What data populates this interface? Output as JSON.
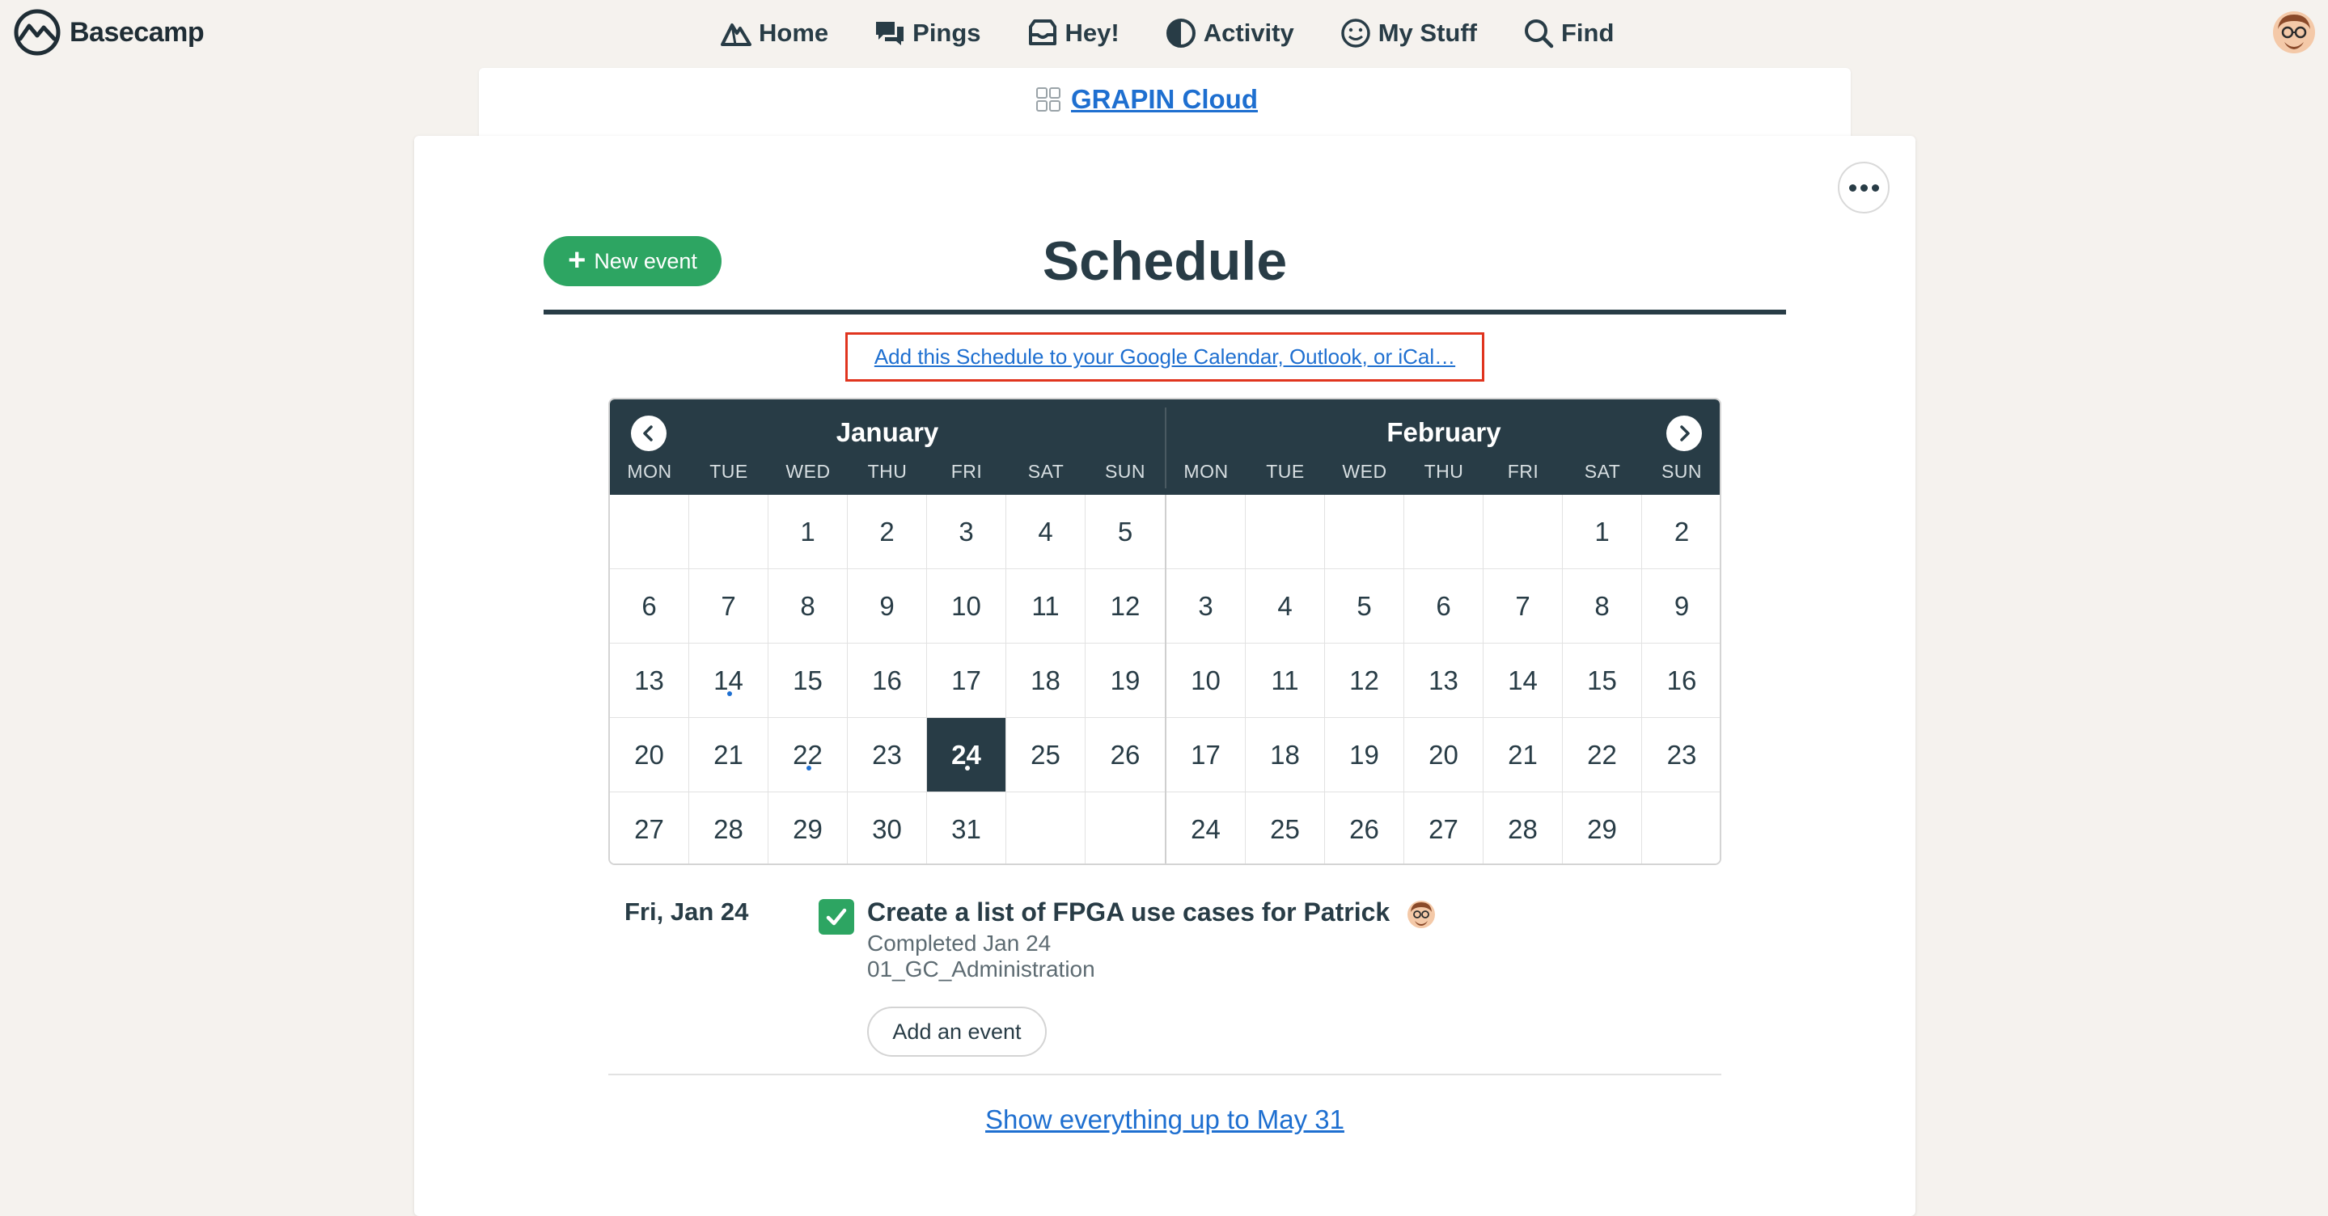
{
  "brand": {
    "name": "Basecamp",
    "logo_icon": "basecamp-logo-icon"
  },
  "nav": {
    "items": [
      {
        "label": "Home",
        "icon": "mountain-icon"
      },
      {
        "label": "Pings",
        "icon": "chat-bubbles-icon"
      },
      {
        "label": "Hey!",
        "icon": "inbox-tray-icon"
      },
      {
        "label": "Activity",
        "icon": "pie-icon"
      },
      {
        "label": "My Stuff",
        "icon": "smiley-icon"
      },
      {
        "label": "Find",
        "icon": "search-icon"
      }
    ],
    "avatar_icon": "user-avatar-icon"
  },
  "project": {
    "name": "GRAPIN Cloud",
    "icon": "grid-icon"
  },
  "page": {
    "title": "Schedule",
    "new_event_label": "New event",
    "subscribe_link": "Add this Schedule to your Google Calendar, Outlook, or iCal…",
    "more_icon": "more-dots-icon",
    "show_more_link": "Show everything up to May 31"
  },
  "calendar": {
    "months": [
      {
        "name": "January",
        "weekdays": [
          "MON",
          "TUE",
          "WED",
          "THU",
          "FRI",
          "SAT",
          "SUN"
        ],
        "weeks": [
          [
            "",
            "",
            "1",
            "2",
            "3",
            "4",
            "5"
          ],
          [
            "6",
            "7",
            "8",
            "9",
            "10",
            "11",
            "12"
          ],
          [
            "13",
            "14",
            "15",
            "16",
            "17",
            "18",
            "19"
          ],
          [
            "20",
            "21",
            "22",
            "23",
            "24",
            "25",
            "26"
          ],
          [
            "27",
            "28",
            "29",
            "30",
            "31",
            "",
            ""
          ]
        ],
        "days_with_events": [
          "14",
          "22",
          "24"
        ],
        "today": "24"
      },
      {
        "name": "February",
        "weekdays": [
          "MON",
          "TUE",
          "WED",
          "THU",
          "FRI",
          "SAT",
          "SUN"
        ],
        "weeks": [
          [
            "",
            "",
            "",
            "",
            "",
            "1",
            "2"
          ],
          [
            "3",
            "4",
            "5",
            "6",
            "7",
            "8",
            "9"
          ],
          [
            "10",
            "11",
            "12",
            "13",
            "14",
            "15",
            "16"
          ],
          [
            "17",
            "18",
            "19",
            "20",
            "21",
            "22",
            "23"
          ],
          [
            "24",
            "25",
            "26",
            "27",
            "28",
            "29",
            ""
          ]
        ],
        "days_with_events": [],
        "today": ""
      }
    ],
    "prev_icon": "chevron-left-icon",
    "next_icon": "chevron-right-icon"
  },
  "events": {
    "date_heading": "Fri, Jan 24",
    "item": {
      "title": "Create a list of FPGA use cases for Patrick",
      "completed": true,
      "status": "Completed Jan 24",
      "list": "01_GC_Administration"
    },
    "add_label": "Add an event"
  },
  "colors": {
    "accent_green": "#2da562",
    "dark": "#283c46",
    "link_blue": "#1e6fd0",
    "highlight_red": "#e0341e",
    "background": "#f5f2ee"
  }
}
